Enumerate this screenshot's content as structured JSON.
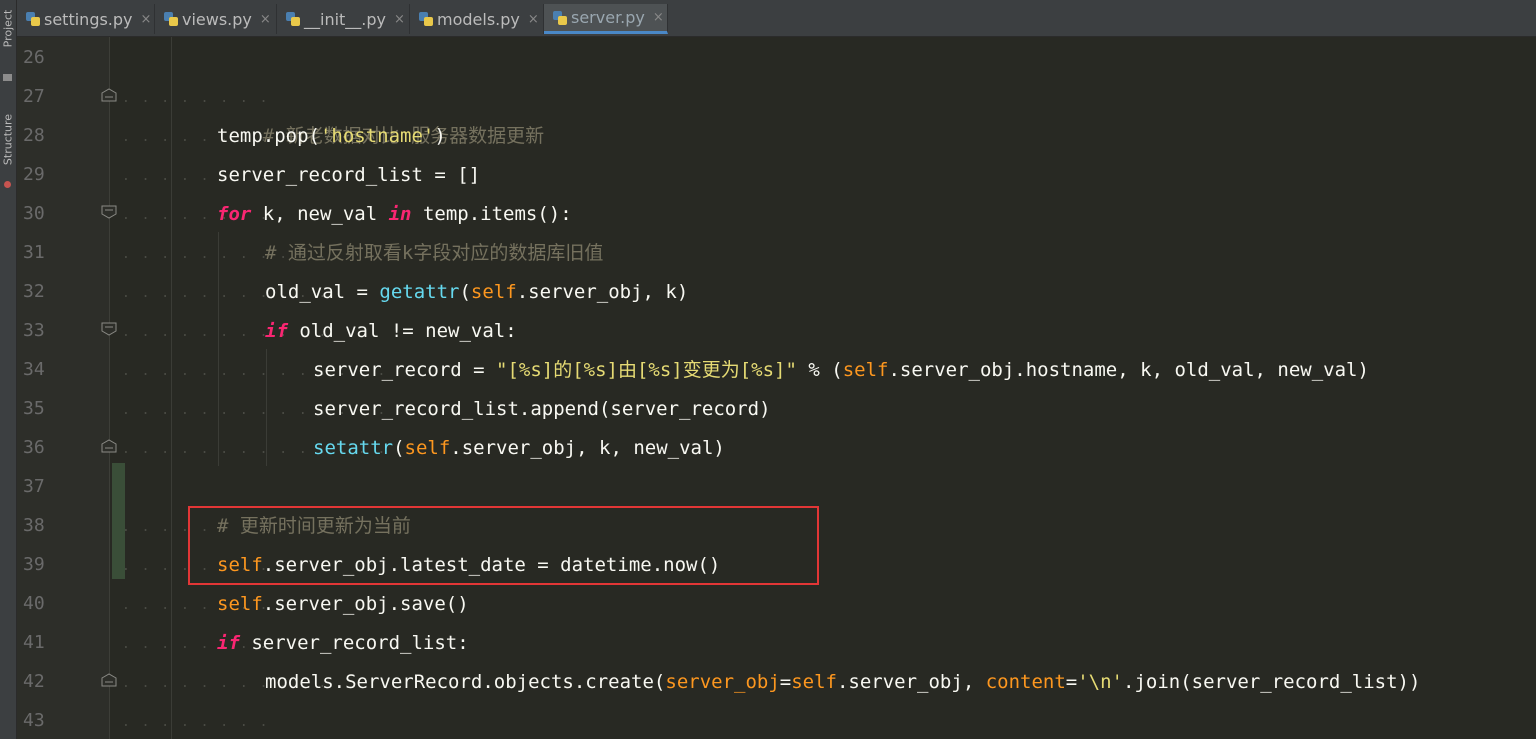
{
  "tool_windows": [
    {
      "label": "Project",
      "icon": "project-icon"
    },
    {
      "label": "Structure",
      "icon": "structure-icon"
    }
  ],
  "tabs": [
    {
      "label": "settings.py",
      "active": false
    },
    {
      "label": "views.py",
      "active": false
    },
    {
      "label": "__init__.py",
      "active": false
    },
    {
      "label": "models.py",
      "active": false
    },
    {
      "label": "server.py",
      "active": true
    }
  ],
  "close_glyph": "×",
  "line_numbers": [
    "26",
    "27",
    "28",
    "29",
    "30",
    "31",
    "32",
    "33",
    "34",
    "35",
    "36",
    "37",
    "38",
    "39",
    "40",
    "41",
    "42",
    "43"
  ],
  "colors": {
    "keyword": "#f92672",
    "self": "#fd971f",
    "string": "#e6db74",
    "comment": "#75715e",
    "builtin": "#66d9ef",
    "highlight_border": "#e23636",
    "background": "#282923"
  },
  "code": {
    "l27_comment": "# 新老数据对比 服务器数据更新",
    "l28_a": "temp.pop(",
    "l28_str": "'hostname'",
    "l28_b": ")",
    "l29": "server_record_list = []",
    "l30_for": "for",
    "l30_a": " k, new_val ",
    "l30_in": "in",
    "l30_b": " temp.items():",
    "l31_comment": "# 通过反射取看k字段对应的数据库旧值",
    "l32_a": "old_val = ",
    "l32_fn": "getattr",
    "l32_b": "(",
    "l32_self": "self",
    "l32_c": ".server_obj, k)",
    "l33_if": "if",
    "l33_a": " old_val != new_val:",
    "l34_a": "server_record = ",
    "l34_str": "\"[%s]的[%s]由[%s]变更为[%s]\"",
    "l34_b": " % (",
    "l34_self": "self",
    "l34_c": ".server_obj.hostname, k, old_val, new_val)",
    "l35": "server_record_list.append(server_record)",
    "l36_fn": "setattr",
    "l36_a": "(",
    "l36_self": "self",
    "l36_b": ".server_obj, k, new_val)",
    "l38_comment": "# 更新时间更新为当前",
    "l39_self": "self",
    "l39_a": ".server_obj.latest_date = datetime.now()",
    "l40_self": "self",
    "l40_a": ".server_obj.save()",
    "l41_if": "if",
    "l41_a": " server_record_list:",
    "l42_a": "models.ServerRecord.objects.create(",
    "l42_p1": "server_obj",
    "l42_b": "=",
    "l42_self": "self",
    "l42_c": ".server_obj, ",
    "l42_p2": "content",
    "l42_d": "=",
    "l42_str": "'\\n'",
    "l42_e": ".join(server_record_list))"
  }
}
